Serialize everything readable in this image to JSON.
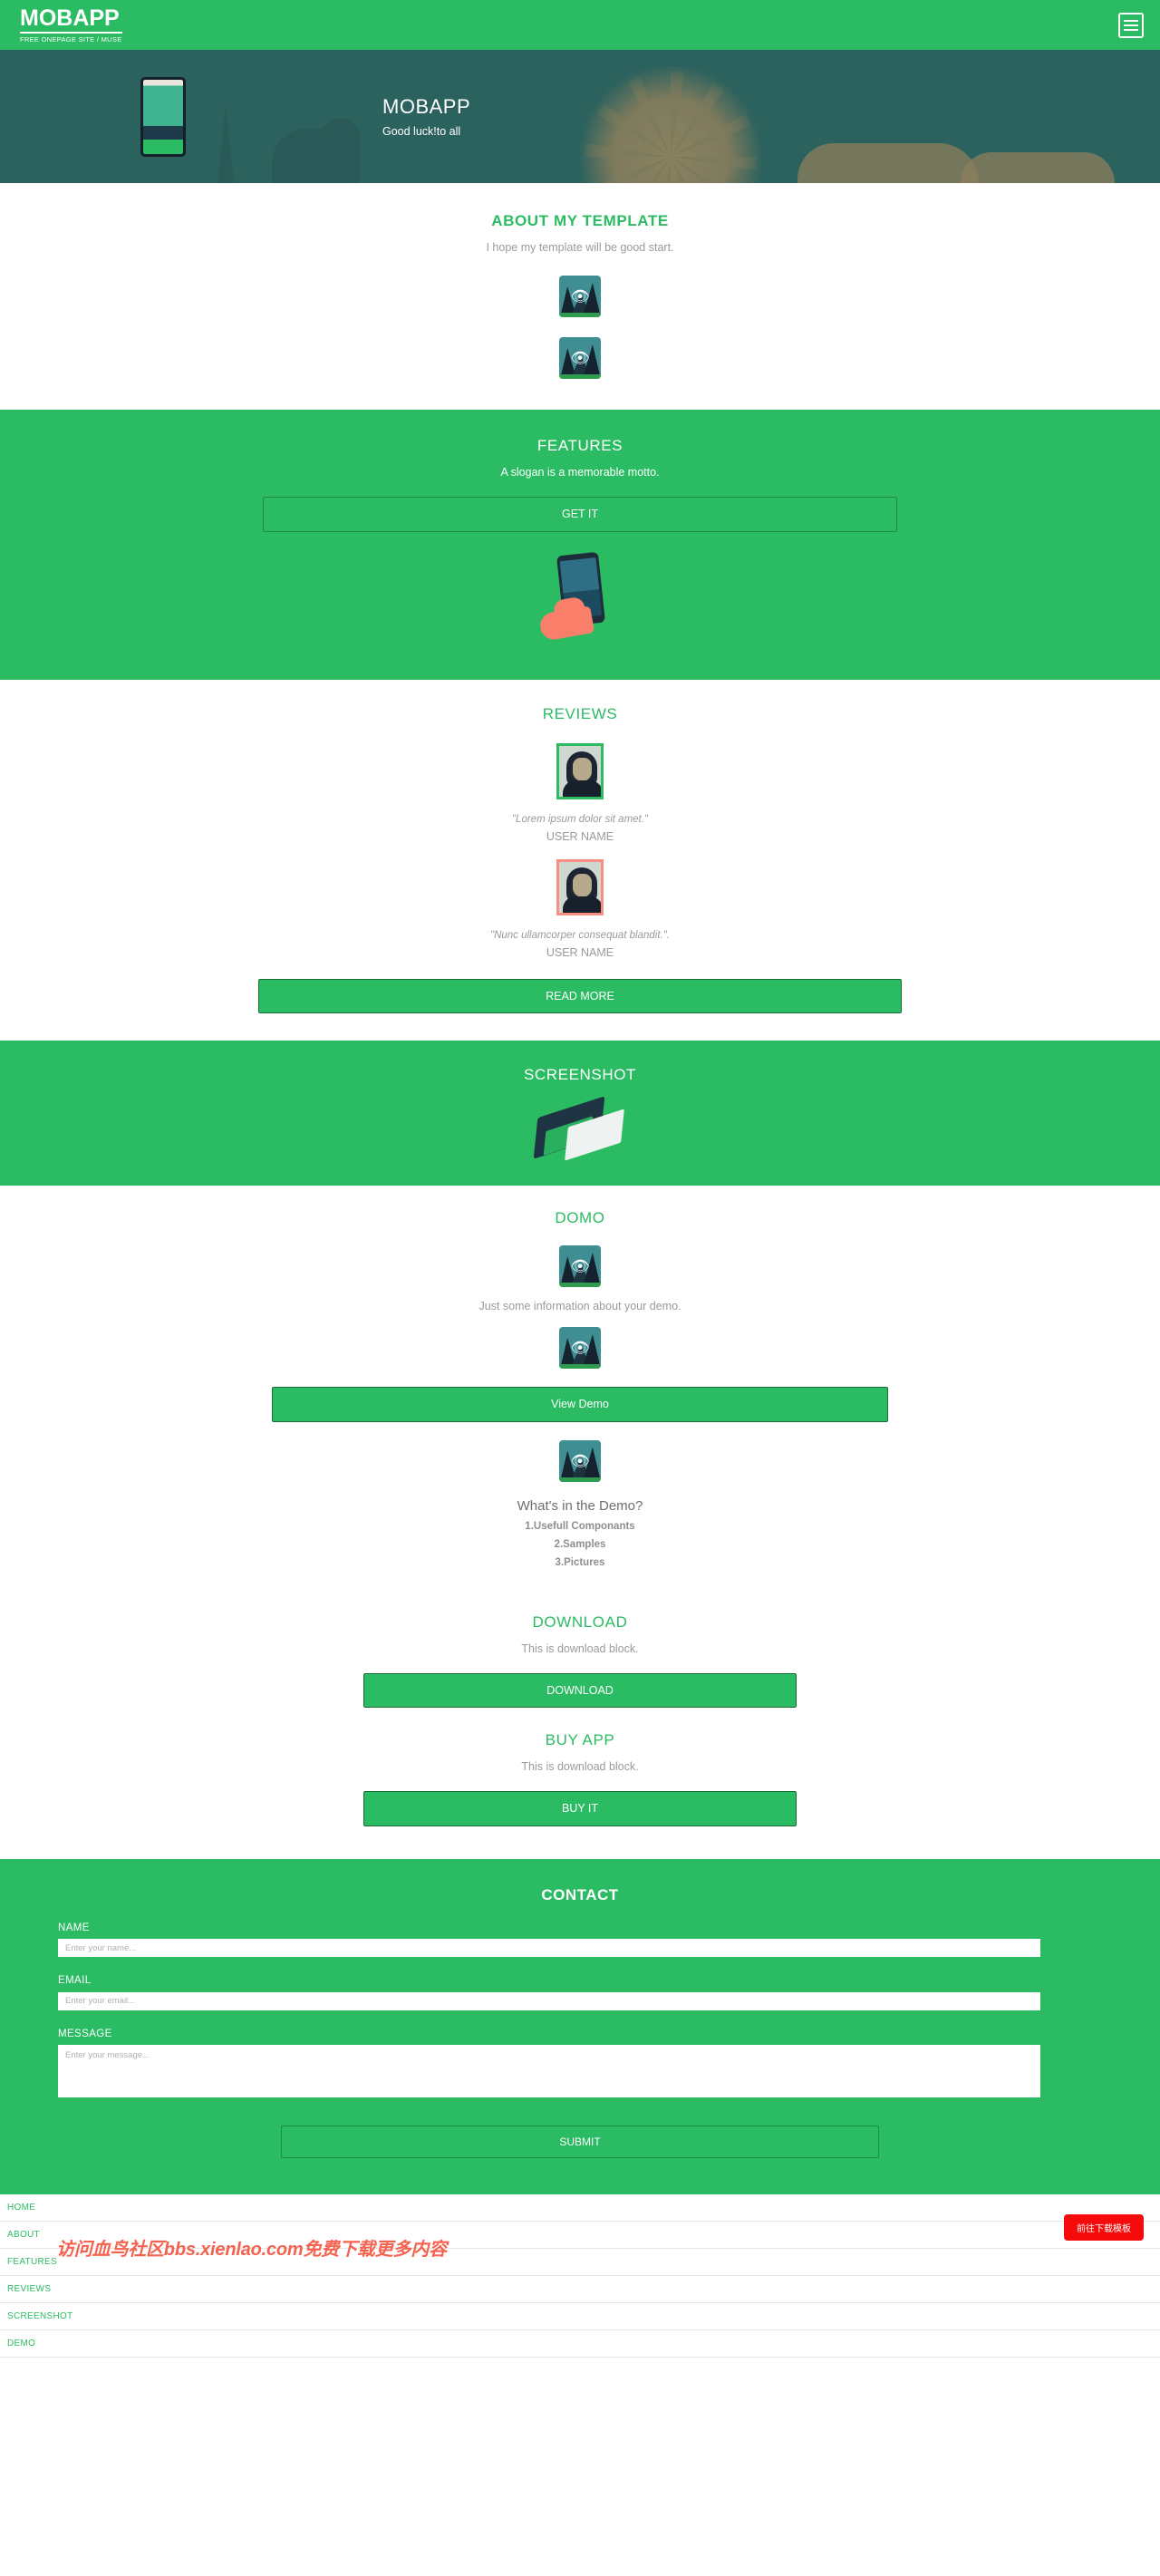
{
  "navbar": {
    "brand_title": "MOBAPP",
    "brand_subtitle": "FREE ONEPAGE SITE / MUSE",
    "menu_icon": "hamburger-menu-icon"
  },
  "hero": {
    "title": "MOBAPP",
    "subtitle": "Good luck!to all"
  },
  "about": {
    "title": "ABOUT MY TEMPLATE",
    "subtitle": "I hope my template will be good start.",
    "icon_1": "eye-icon",
    "icon_2": "eye-icon"
  },
  "features": {
    "title": "FEATURES",
    "subtitle": "A slogan is a memorable motto.",
    "button_label": "GET IT"
  },
  "reviews": {
    "title": "REVIEWS",
    "items": [
      {
        "quote": "\"Lorem ipsum dolor sit amet.\"",
        "name": "USER NAME",
        "border_color": "#2bbc63"
      },
      {
        "quote": "\"Nunc ullamcorper consequat blandit.\".",
        "name": "USER NAME",
        "border_color": "#f79083"
      }
    ],
    "button_label": "READ MORE"
  },
  "screenshot": {
    "title": "SCREENSHOT"
  },
  "demo": {
    "title": "DOMO",
    "info": "Just some information about your demo.",
    "button_label": "View Demo",
    "question": "What's in the Demo?",
    "list": [
      "1.Usefull Componants",
      "2.Samples",
      "3.Pictures"
    ]
  },
  "download": {
    "title": "DOWNLOAD",
    "subtitle": "This is download block.",
    "button_label": "DOWNLOAD"
  },
  "buy": {
    "title": "BUY APP",
    "subtitle": "This is download block.",
    "button_label": "BUY IT"
  },
  "contact": {
    "title": "CONTACT",
    "name_label": "NAME",
    "name_placeholder": "Enter your name...",
    "name_value": "",
    "email_label": "EMAIL",
    "email_placeholder": "Enter your email...",
    "email_value": "",
    "message_label": "MESSAGE",
    "message_placeholder": "Enter your message...",
    "message_value": "",
    "submit_label": "SUBMIT"
  },
  "footer": {
    "links": [
      "HOME",
      "ABOUT",
      "FEATURES",
      "REVIEWS",
      "SCREENSHOT",
      "DEMO"
    ],
    "watermark": "访问血鸟社区bbs.xienlao.com免费下载更多内容",
    "download_button": "前往下载模板"
  },
  "colors": {
    "brand_green": "#2bbc63",
    "hero_teal": "#2c625e",
    "accent_red": "#f50b0b",
    "coral": "#f79083",
    "muted_text": "#9a9a9a"
  }
}
